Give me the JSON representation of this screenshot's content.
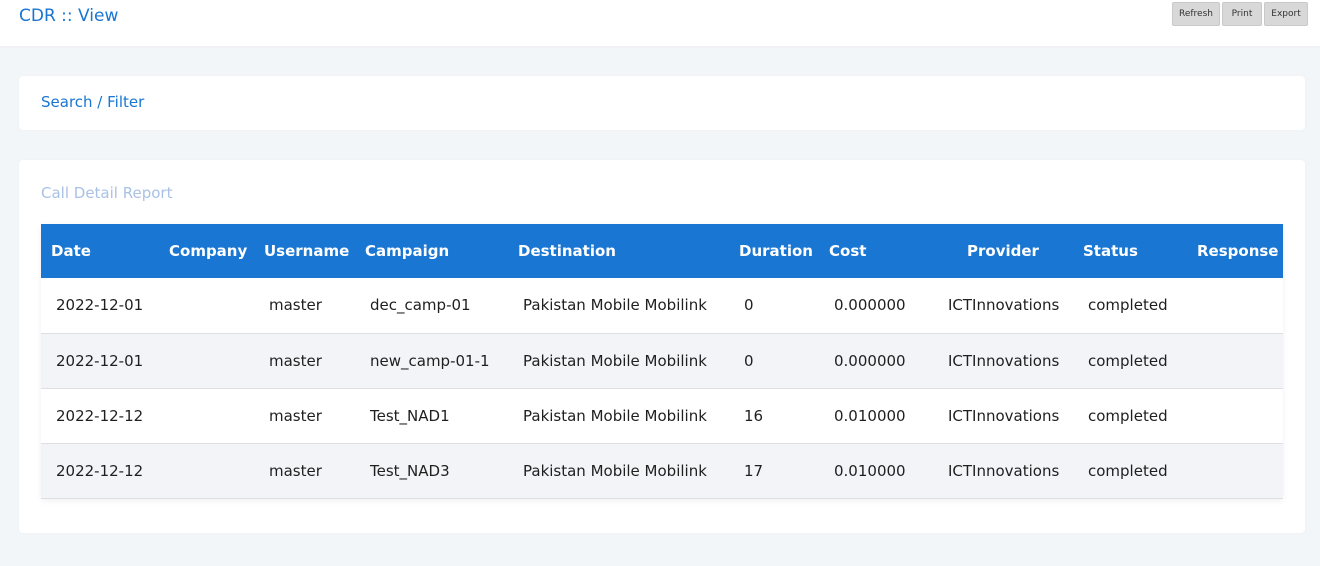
{
  "header": {
    "title": "CDR :: View",
    "buttons": {
      "refresh": "Refresh",
      "print": "Print",
      "export": "Export"
    }
  },
  "filter": {
    "title": "Search / Filter"
  },
  "report": {
    "title": "Call Detail Report",
    "columns": [
      "Date",
      "Company",
      "Username",
      "Campaign",
      "Destination",
      "Duration",
      "Cost",
      "Provider",
      "Status",
      "Response"
    ],
    "rows": [
      [
        "2022-12-01",
        "",
        "master",
        "dec_camp-01",
        "Pakistan Mobile Mobilink",
        "0",
        "0.000000",
        "ICTInnovations",
        "completed",
        ""
      ],
      [
        "2022-12-01",
        "",
        "master",
        "new_camp-01-1",
        "Pakistan Mobile Mobilink",
        "0",
        "0.000000",
        "ICTInnovations",
        "completed",
        ""
      ],
      [
        "2022-12-12",
        "",
        "master",
        "Test_NAD1",
        "Pakistan Mobile Mobilink",
        "16",
        "0.010000",
        "ICTInnovations",
        "completed",
        ""
      ],
      [
        "2022-12-12",
        "",
        "master",
        "Test_NAD3",
        "Pakistan Mobile Mobilink",
        "17",
        "0.010000",
        "ICTInnovations",
        "completed",
        ""
      ]
    ]
  },
  "colors": {
    "accent": "#1976d2",
    "header_bg": "#1976d2",
    "muted_title": "#a9c1e6"
  }
}
